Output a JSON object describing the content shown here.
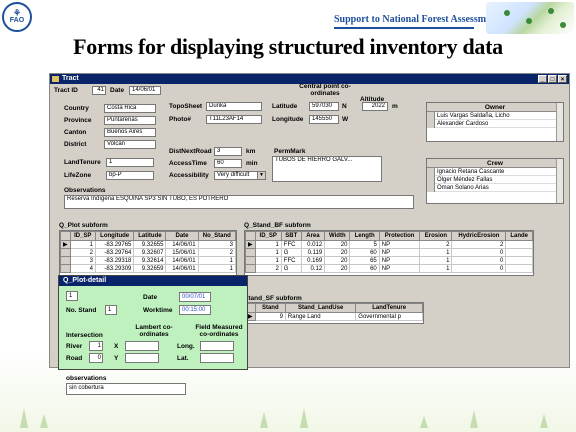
{
  "header": {
    "logo": "FAO",
    "support_text": "Support to National Forest Assessments",
    "title": "Forms for displaying structured inventory data"
  },
  "window": {
    "title": "Tract",
    "tract_id_label": "Tract ID",
    "tract_id": "41",
    "date_label": "Date",
    "date": "14/06/01",
    "country_label": "Country",
    "country": "Costa Rica",
    "province_label": "Province",
    "province": "Puntarenas",
    "canton_label": "Canton",
    "canton": "Buenos Aires",
    "district_label": "District",
    "district": "Volcán",
    "topo_label": "TopoSheet",
    "topo": "Durika",
    "photo_label": "Photo#",
    "photo": "T11L23AF14",
    "central_label": "Central point co-ordinates",
    "latitude_label": "Latitude",
    "latitude": "597030",
    "lat_dir": "N",
    "longitude_label": "Longitude",
    "longitude": "145550",
    "long_dir": "W",
    "altitude_label": "Altitude",
    "altitude": "2022",
    "altitude_unit": "m",
    "landtenure_label": "LandTenure",
    "landtenure": "1",
    "lifezone_label": "LifeZone",
    "lifezone": "bp-P",
    "distroad_label": "DistNextRoad",
    "distroad": "3",
    "distroad_unit": "km",
    "access_label": "AccessTime",
    "access": "60",
    "access_unit": "min",
    "accessibility_label": "Accessibility",
    "accessibility": "Very difficult",
    "permmark_label": "PermMark",
    "permmark": "TUBOS DE HIERRO GALV...",
    "observations_label": "Observations",
    "observations": "Reserva Indígena ESQUINA SP3 SIN TUBO, ES POTRERO",
    "owner_header": "Owner",
    "owners": [
      "Luis Vargas Saldaña, Licho",
      "Alexander Cardoso"
    ],
    "crew_header": "Crew",
    "crew": [
      "Ignacio Retana Cascante",
      "Olger Méndez Fallas",
      "Oman Solano Arias"
    ]
  },
  "plot_subform": {
    "label": "Q_Plot subform",
    "columns": [
      "ID_SP",
      "Longitude",
      "Latitude",
      "Date",
      "No_Stand"
    ],
    "rows": [
      [
        "1",
        "-83.29765",
        "9.32655",
        "14/06/01",
        "3"
      ],
      [
        "2",
        "-83.29764",
        "9.32607",
        "15/06/01",
        "2"
      ],
      [
        "3",
        "-83.29318",
        "9.32614",
        "14/06/01",
        "1"
      ],
      [
        "4",
        "-83.29309",
        "9.32659",
        "14/06/01",
        "1"
      ]
    ]
  },
  "bf_subform": {
    "label": "Q_Stand_BF subform",
    "columns": [
      "ID_SP",
      "SBT",
      "Area",
      "Width",
      "Length",
      "Protection",
      "Erosion",
      "HydricErosion",
      "Lande"
    ],
    "rows": [
      [
        "1",
        "FFC",
        "0.012",
        "20",
        "5",
        "NP",
        "2",
        "2",
        ""
      ],
      [
        "1",
        "G",
        "0.119",
        "20",
        "60",
        "NP",
        "1",
        "0",
        ""
      ],
      [
        "1",
        "FFC",
        "0.169",
        "20",
        "65",
        "NP",
        "1",
        "0",
        ""
      ],
      [
        "2",
        "G",
        "0.12",
        "20",
        "60",
        "NP",
        "1",
        "0",
        ""
      ]
    ]
  },
  "sf_subform": {
    "label": "Stand_SF subform",
    "columns": [
      "Stand",
      "Stand_LandUse",
      "LandTenure"
    ],
    "rows": [
      [
        "9",
        "Range Land",
        "Governmental p"
      ]
    ]
  },
  "plot_detail": {
    "title": "Q_Plot-detail",
    "id_value": "1",
    "no_stand_label": "No. Stand",
    "no_stand": "1",
    "date_label": "Date",
    "date": "00/07/01",
    "worktime_label": "Worktime",
    "worktime": "00:15:00",
    "intersection_label": "Intersection",
    "river_label": "River",
    "river": "1",
    "road_label": "Road",
    "road": "0",
    "lambert_label": "Lambert co-ordinates",
    "x_label": "X",
    "y_label": "Y",
    "field_label": "Field Measured co-ordinates",
    "long_label": "Long.",
    "lat_label": "Lat.",
    "obs_label": "observations",
    "obs": "sin cobertura"
  }
}
